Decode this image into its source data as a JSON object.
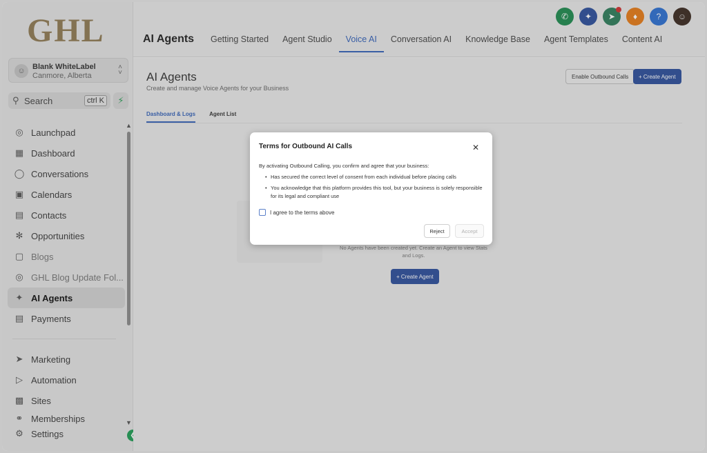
{
  "brand": {
    "logo_text": "GHL"
  },
  "account": {
    "name": "Blank WhiteLabel",
    "location": "Canmore, Alberta"
  },
  "search": {
    "label": "Search",
    "shortcut": "ctrl K"
  },
  "sidebar": {
    "items": [
      {
        "label": "Launchpad",
        "icon": "rocket-icon"
      },
      {
        "label": "Dashboard",
        "icon": "grid-icon"
      },
      {
        "label": "Conversations",
        "icon": "chat-icon"
      },
      {
        "label": "Calendars",
        "icon": "calendar-icon"
      },
      {
        "label": "Contacts",
        "icon": "contacts-icon"
      },
      {
        "label": "Opportunities",
        "icon": "opportunities-icon"
      },
      {
        "label": "Blogs",
        "icon": "blog-icon"
      },
      {
        "label": "GHL Blog Update Fol...",
        "icon": "folder-icon"
      },
      {
        "label": "AI Agents",
        "icon": "sparkle-icon"
      },
      {
        "label": "Payments",
        "icon": "payments-icon"
      }
    ],
    "items2": [
      {
        "label": "Marketing",
        "icon": "send-icon"
      },
      {
        "label": "Automation",
        "icon": "automation-icon"
      },
      {
        "label": "Sites",
        "icon": "sites-icon"
      },
      {
        "label": "Memberships",
        "icon": "membership-icon"
      },
      {
        "label": "Settings",
        "icon": "gear-icon"
      }
    ]
  },
  "header": {
    "title": "AI Agents",
    "tabs": [
      "Getting Started",
      "Agent Studio",
      "Voice AI",
      "Conversation AI",
      "Knowledge Base",
      "Agent Templates",
      "Content AI"
    ],
    "active_tab": "Voice AI"
  },
  "header_icons": {
    "phone_color": "#1e8a4f",
    "sparkle_color": "#2c4f9c",
    "megaphone_color": "#2e7d5b",
    "bell_color": "#e67a17",
    "help_color": "#2c6fd1",
    "help_label": "?"
  },
  "page": {
    "title": "AI Agents",
    "subtitle": "Create and manage Voice Agents for your Business",
    "enable_outbound_label": "Enable Outbound Calls",
    "create_agent_label": "+ Create Agent",
    "subtabs": [
      "Dashboard & Logs",
      "Agent List"
    ],
    "empty_text": "No Agents have been created yet. Create an Agent to view Stats and Logs.",
    "create_agent_center_label": "+ Create Agent"
  },
  "modal": {
    "title": "Terms for Outbound AI Calls",
    "close_label": "✕",
    "intro": "By activating Outbound Calling, you confirm and agree that your business:",
    "bullets": [
      "Has secured the correct level of consent from each individual before placing calls",
      "You acknowledge that this platform provides this tool, but your business is solely responsible for its legal and compliant use"
    ],
    "agree_label": "I agree to the terms above",
    "agree_checked": false,
    "reject_label": "Reject",
    "accept_label": "Accept"
  }
}
